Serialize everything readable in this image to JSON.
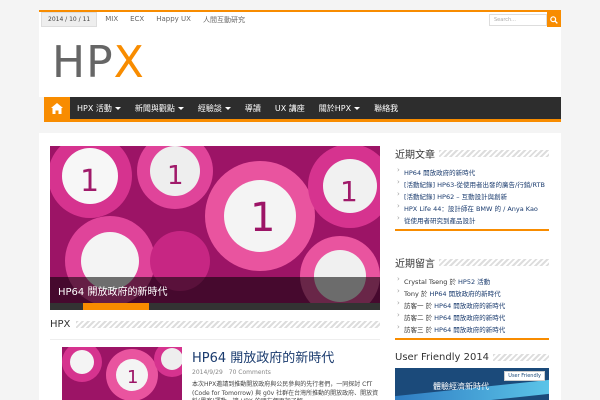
{
  "topbar": {
    "date": "2014 / 10 / 11",
    "links": [
      "MIX",
      "ECX",
      "Happy UX",
      "人間互動研究"
    ],
    "search_placeholder": "Search..."
  },
  "logo": {
    "hp": "HP",
    "x": "X"
  },
  "nav": {
    "items": [
      {
        "label": "HPX 活動",
        "dropdown": true
      },
      {
        "label": "新聞與觀點",
        "dropdown": true
      },
      {
        "label": "經驗談",
        "dropdown": true
      },
      {
        "label": "導讀",
        "dropdown": false
      },
      {
        "label": "UX 講座",
        "dropdown": false
      },
      {
        "label": "關於HPX",
        "dropdown": true
      },
      {
        "label": "聯絡我",
        "dropdown": false
      }
    ]
  },
  "slider": {
    "caption": "HP64 開放政府的新時代"
  },
  "section": {
    "title": "HPX"
  },
  "post": {
    "title": "HP64 開放政府的新時代",
    "date": "2014/9/29",
    "comments": "70 Comments",
    "excerpt": "本次HPX邀請到推動開放政府與公民參與的先行者們，一同探討 CfT (Code for Tomorrow) 與 g0v 社群在台灣所推動的開放政府、開放資料(黑客)運動，讓 HPX 的朋友們更加了解"
  },
  "widgets": {
    "recent": {
      "title": "近期文章",
      "items": [
        "HP64 開放政府的新時代",
        "[活動紀錄] HP63-從使用者出發的廣告/行銷/RTB",
        "[活動紀錄] HP62 – 互動設計與創新",
        "HPX Life 44：設計師在 BMW 的 / Anya Kao",
        "從使用者研究到產品設計"
      ]
    },
    "comments": {
      "title": "近期留言",
      "items": [
        {
          "author": "Crystal Tseng",
          "on": "於",
          "post": "HP52 活動"
        },
        {
          "author": "Tony",
          "on": "於",
          "post": "HP64 開放政府的新時代"
        },
        {
          "author": "訪客一",
          "on": "於",
          "post": "HP64 開放政府的新時代"
        },
        {
          "author": "訪客二",
          "on": "於",
          "post": "HP64 開放政府的新時代"
        },
        {
          "author": "訪客三",
          "on": "於",
          "post": "HP64 開放政府的新時代"
        }
      ]
    },
    "banner": {
      "title": "User Friendly 2014",
      "tag": "User Friendly",
      "text": "體驗經濟新時代"
    }
  },
  "colors": {
    "accent": "#f88c00",
    "nav_bg": "#2d2d2d",
    "link": "#1a3b6e",
    "slide": "#b01d78"
  }
}
